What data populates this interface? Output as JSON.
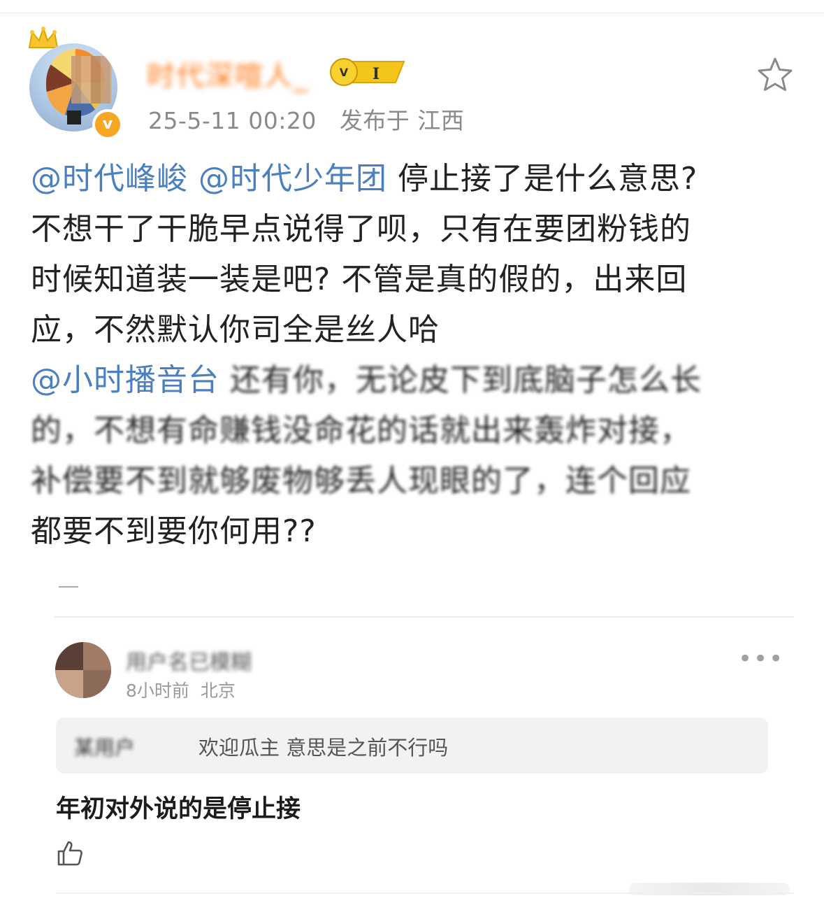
{
  "post": {
    "username": "时代深喧人_",
    "level": "I",
    "timestamp": "25-5-11 00:20",
    "location": "发布于 江西",
    "body": [
      {
        "mention1": "@时代峰峻",
        "mention2": "@时代少年团",
        "text": " 停止接了是什么意思?"
      },
      {
        "text": "不想干了干脆早点说得了呗，只有在要团粉钱的"
      },
      {
        "text": "时候知道装一装是吧? 不管是真的假的，出来回"
      },
      {
        "text": "应，不然默认你司全是丝人哈"
      },
      {
        "mention": "@小时播音台",
        "text": " 还有你，无论皮下到底脑子怎么长"
      },
      {
        "text": "的，不想有命赚钱没命花的话就出来轰炸对接，"
      },
      {
        "text": "补偿要不到就够废物够丢人现眼的了，连个回应"
      },
      {
        "text": "都要不到要你何用??"
      }
    ]
  },
  "comment": {
    "username": "用户名已模糊",
    "time": "8小时前",
    "location": "北京",
    "quote_user": "某用户",
    "quote_text": "欢迎瓜主 意思是之前不行吗",
    "reply": "年初对外说的是停止接"
  },
  "icons": {
    "star": "star-outline-icon",
    "more": "more-dots-icon",
    "like": "thumbs-up-icon",
    "verified": "verified-badge-icon",
    "crown": "crown-icon"
  },
  "colors": {
    "mention": "#4a7fc0",
    "username": "#ff7b1a",
    "meta": "#8a8a8a",
    "verified": "#f6a623"
  }
}
